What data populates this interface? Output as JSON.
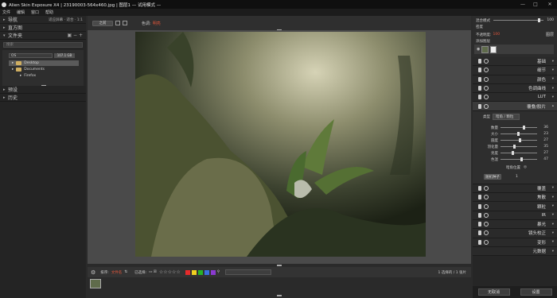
{
  "window": {
    "title": "Alien Skin Exposure X4 | 23190003-564x460.jpg | 图层1 — 试用模式 —",
    "controls": [
      "—",
      "□",
      "✕"
    ]
  },
  "menu": [
    "文件",
    "编辑",
    "窗口",
    "帮助"
  ],
  "left": {
    "nav_label": "导航",
    "nav_right": "适应屏幕 · 适合 · 1:1",
    "histogram_label": "直方图",
    "folders_label": "文件夹",
    "search_placeholder": "搜索",
    "tree_root": "OS",
    "tree_root_size": "107.1 GB",
    "tree_items": [
      "Desktop",
      "Documents",
      "Firefox"
    ],
    "presets_label": "预设",
    "history_label": "历史"
  },
  "center": {
    "compare_label": "之前",
    "tone_label": "色调:",
    "tone_value": "明亮",
    "sort_label": "排序:",
    "sort_value": "文件名",
    "select_label": "已选择:",
    "status_text": "1 选择的 / 1 张片"
  },
  "right": {
    "opacity_label": "混合模式",
    "opacity_value": "100",
    "blend_label": "不透明度:",
    "blend_value": "100",
    "layer_add_label": "添加图层",
    "layer_mode": "图层",
    "panels": [
      "基础",
      "细节",
      "颜色",
      "色调曲线",
      "LUT",
      "覆叠/胶片",
      "覆盖",
      "焦散",
      "颗粒",
      "IR",
      "暴光",
      "镜头校正",
      "变形",
      "元数据"
    ],
    "open_panel_index": 5,
    "sub_type_label": "类型",
    "sub_type_value": "暗角 / 颗粒",
    "sub_sliders": [
      {
        "label": "数量",
        "value": "36"
      },
      {
        "label": "大小",
        "value": "23"
      },
      {
        "label": "圆度",
        "value": "27"
      },
      {
        "label": "羽化量",
        "value": "35"
      },
      {
        "label": "亮度",
        "value": "27"
      },
      {
        "label": "色温",
        "value": "47"
      }
    ],
    "sub_center_label": "暗角位置",
    "sub_btn_label": "随机种子",
    "sub_btn_value": "1",
    "reset_label": "无取消",
    "apply_label": "设置"
  },
  "colors": {
    "swatches": [
      "#e52b2b",
      "#f0d020",
      "#27b327",
      "#3a6fe0",
      "#8b3ad0"
    ]
  }
}
